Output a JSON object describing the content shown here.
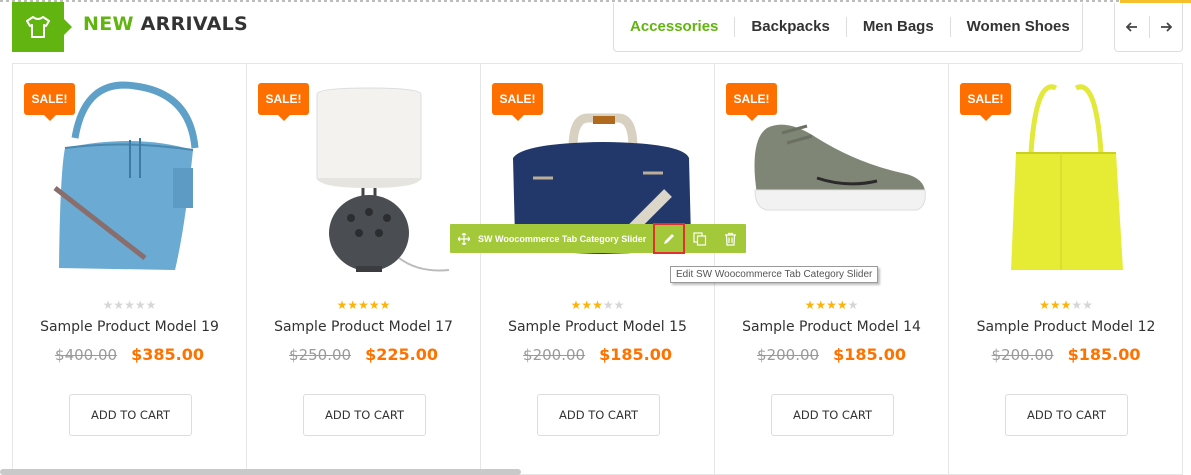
{
  "section": {
    "title_highlight": "NEW",
    "title_rest": " ARRIVALS",
    "icon": "tshirt-icon"
  },
  "tabs": [
    {
      "label": "Accessories",
      "active": true
    },
    {
      "label": "Backpacks",
      "active": false
    },
    {
      "label": "Men Bags",
      "active": false
    },
    {
      "label": "Women Shoes",
      "active": false
    }
  ],
  "nav": {
    "prev_icon": "arrow-left-icon",
    "next_icon": "arrow-right-icon"
  },
  "products": [
    {
      "badge": "SALE!",
      "name": "Sample Product Model 19",
      "old_price": "$400.00",
      "price": "$385.00",
      "rating": 0,
      "cart_label": "ADD TO CART",
      "image": "blue-handbag"
    },
    {
      "badge": "SALE!",
      "name": "Sample Product Model 17",
      "old_price": "$250.00",
      "price": "$225.00",
      "rating": 5,
      "cart_label": "ADD TO CART",
      "image": "table-lamp"
    },
    {
      "badge": "SALE!",
      "name": "Sample Product Model 15",
      "old_price": "$200.00",
      "price": "$185.00",
      "rating": 3,
      "cart_label": "ADD TO CART",
      "image": "navy-duffel-bag"
    },
    {
      "badge": "SALE!",
      "name": "Sample Product Model 14",
      "old_price": "$200.00",
      "price": "$185.00",
      "rating": 4,
      "cart_label": "ADD TO CART",
      "image": "grey-sneaker"
    },
    {
      "badge": "SALE!",
      "name": "Sample Product Model 12",
      "old_price": "$200.00",
      "price": "$185.00",
      "rating": 3,
      "cart_label": "ADD TO CART",
      "image": "yellow-tote-bag"
    }
  ],
  "editor": {
    "label": "SW Woocommerce Tab Category Slider",
    "tooltip": "Edit SW Woocommerce Tab Category Slider"
  },
  "colors": {
    "accent": "#62b410",
    "sale": "#fe6f00",
    "price": "#fe7200",
    "editbar": "#a3c83a",
    "star": "#fdb40a"
  }
}
